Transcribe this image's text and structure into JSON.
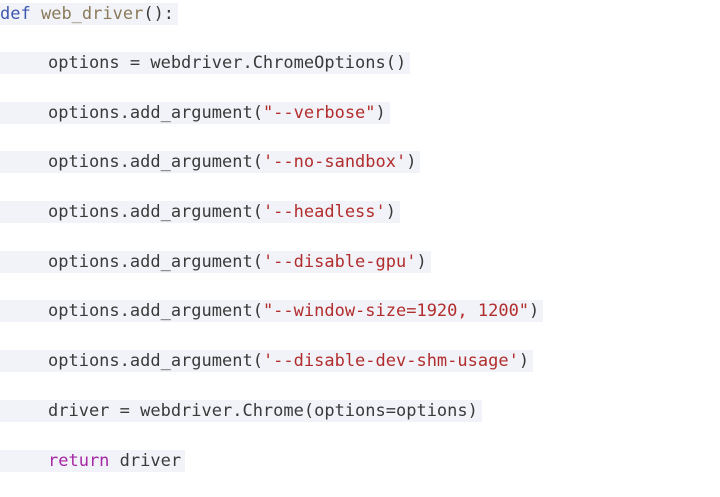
{
  "code": {
    "def_keyword": "def",
    "function_name": "web_driver",
    "signature_tail": "():",
    "line1": "options = webdriver.ChromeOptions()",
    "arg_call": "options.add_argument(",
    "arg_close": ")",
    "arg_verbose": "\"--verbose\"",
    "arg_no_sandbox": "'--no-sandbox'",
    "arg_headless": "'--headless'",
    "arg_disable_gpu": "'--disable-gpu'",
    "arg_window_size": "\"--window-size=1920, 1200\"",
    "arg_disable_dev_shm": "'--disable-dev-shm-usage'",
    "driver_line": "driver = webdriver.Chrome(options=options)",
    "return_keyword": "return",
    "return_value": "driver"
  },
  "colors": {
    "line_background": "#f1f3f8",
    "keyword": "#3f56b0",
    "return_keyword": "#a626a4",
    "function_name": "#8a7a5a",
    "string": "#b22d2d",
    "text": "#3a3a3a"
  }
}
